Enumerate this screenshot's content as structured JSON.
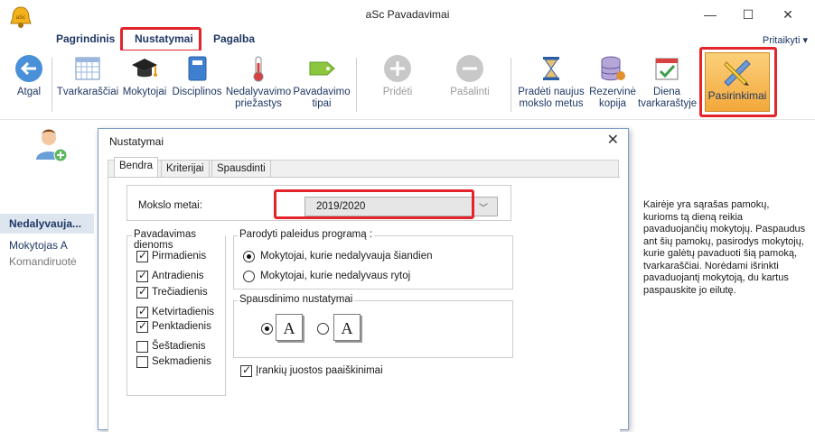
{
  "window": {
    "title": "aSc Pavadavimai",
    "minimize": "—",
    "maximize": "☐",
    "close": "✕"
  },
  "menu": {
    "items": [
      "Pagrindinis",
      "Nustatymai",
      "Pagalba"
    ],
    "customize": "Pritaikyti ▾"
  },
  "toolbar": {
    "back": "Atgal",
    "timetables": "Tvarkaraščiai",
    "teachers": "Mokytojai",
    "subjects": "Disciplinos",
    "absence_reasons_1": "Nedalyvavimo",
    "absence_reasons_2": "priežastys",
    "sub_types_1": "Pavadavimo",
    "sub_types_2": "tipai",
    "add": "Pridėti",
    "remove": "Pašalinti",
    "new_year_1": "Pradėti naujus",
    "new_year_2": "mokslo metus",
    "backup_1": "Rezervinė",
    "backup_2": "kopija",
    "daily_1": "Diena",
    "daily_2": "tvarkaraštyje",
    "choices": "Pasirinkimai"
  },
  "sidebar": {
    "header": "Nedalyvauja...",
    "items": [
      "Mokytojas A",
      "Komandiruotė"
    ]
  },
  "help_text": "Kairėje yra sąrašas pamokų, kurioms tą dieną reikia pavaduojančių mokytojų. Paspaudus ant šių pamokų, pasirodys mokytojų, kurie galėtų pavaduoti šią pamoką, tvarkaraščiai. Norėdami išrinkti pavaduojantį mokytoją, du kartus paspauskite jo eilutę.",
  "dialog": {
    "title": "Nustatymai",
    "close": "✕",
    "tabs": [
      "Bendra",
      "Kriterijai",
      "Spausdinti"
    ],
    "school_year_label": "Mokslo metai:",
    "school_year_value": "2019/2020",
    "days_group": "Pavadavimas dienoms",
    "days": [
      {
        "label": "Pirmadienis",
        "checked": true
      },
      {
        "label": "Antradienis",
        "checked": true
      },
      {
        "label": "Trečiadienis",
        "checked": true
      },
      {
        "label": "Ketvirtadienis",
        "checked": true
      },
      {
        "label": "Penktadienis",
        "checked": true
      },
      {
        "label": "Šeštadienis",
        "checked": false
      },
      {
        "label": "Sekmadienis",
        "checked": false
      }
    ],
    "show_group": "Parodyti paleidus programą :",
    "show_today": "Mokytojai, kurie nedalyvauja šiandien",
    "show_tomorrow": "Mokytojai, kurie nedalyvaus rytoj",
    "print_group": "Spausdinimo nustatymai",
    "page_letter": "A",
    "toolbar_hints": "Įrankių juostos paaiškinimai"
  },
  "colors": {
    "highlight": "#e3242b",
    "accent": "#1f3864",
    "choices_bg": "#f3a83b"
  }
}
